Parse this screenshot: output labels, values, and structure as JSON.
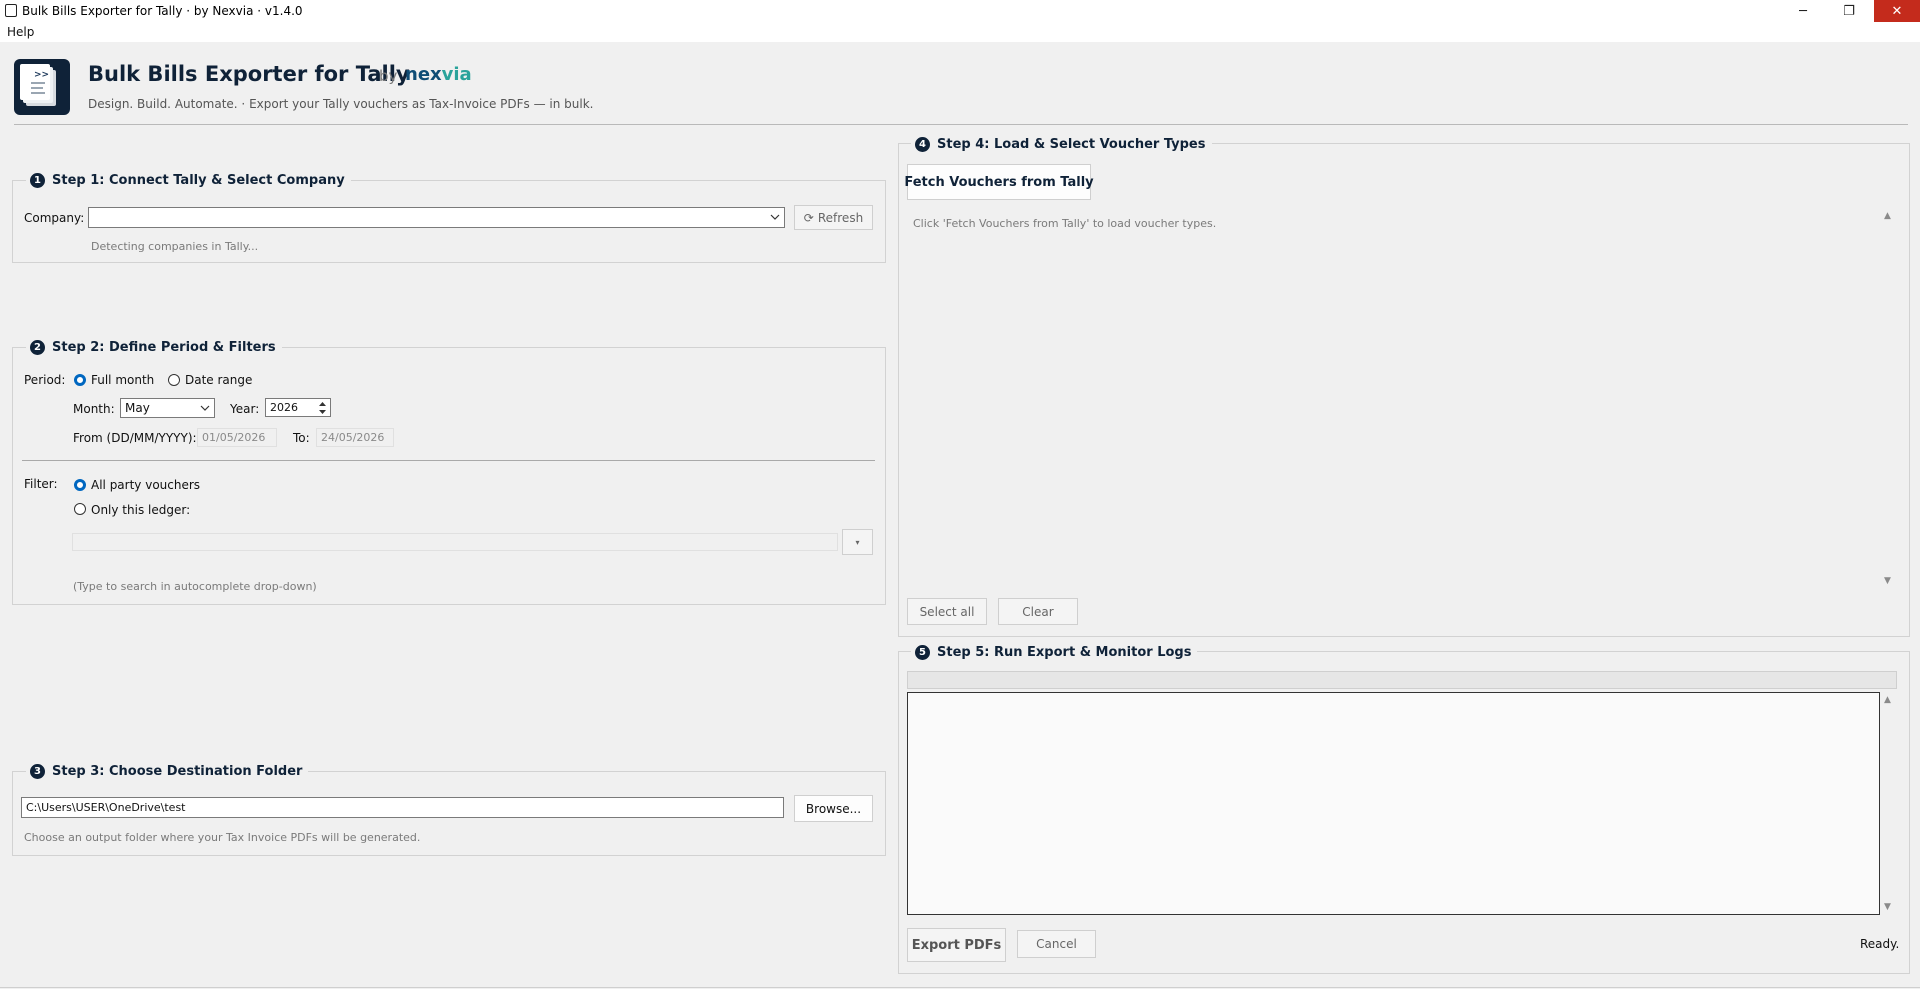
{
  "window": {
    "title": "Bulk Bills Exporter for Tally  ·  by Nexvia  ·  v1.4.0",
    "minimize": "─",
    "restore": "❐",
    "close": "✕"
  },
  "menu": {
    "help": "Help"
  },
  "header": {
    "logo_glyph": ">>",
    "title": "Bulk Bills Exporter for Tally",
    "by": "by",
    "brand_a": "nex",
    "brand_b": "via",
    "subtitle": "Design. Build. Automate.   ·   Export your Tally vouchers as Tax-Invoice PDFs — in bulk."
  },
  "step1": {
    "num": "1",
    "title": "Step 1: Connect Tally & Select Company",
    "company_label": "Company:",
    "company_value": "",
    "refresh_icon": "⟳",
    "refresh_label": "Refresh",
    "status": "Detecting companies in Tally..."
  },
  "step2": {
    "num": "2",
    "title": "Step 2: Define Period & Filters",
    "period_label": "Period:",
    "full_month": "Full month",
    "date_range": "Date range",
    "period_selected": "Full month",
    "month_label": "Month:",
    "month_value": "May",
    "year_label": "Year:",
    "year_value": "2026",
    "from_label": "From (DD/MM/YYYY):",
    "from_value": "01/05/2026",
    "to_label": "To:",
    "to_value": "24/05/2026",
    "filter_label": "Filter:",
    "all_party": "All party vouchers",
    "only_ledger": "Only this ledger:",
    "filter_selected": "All party vouchers",
    "ledger_value": "",
    "ledger_btn": "▾",
    "hint": "(Type to search in autocomplete drop-down)"
  },
  "step3": {
    "num": "3",
    "title": "Step 3: Choose Destination Folder",
    "folder_value": "C:\\Users\\USER\\OneDrive\\test",
    "browse_label": "Browse...",
    "hint": "Choose an output folder where your Tax Invoice PDFs will be generated."
  },
  "step4": {
    "num": "4",
    "title": "Step 4: Load & Select Voucher Types",
    "fetch_label": "Fetch Vouchers from Tally",
    "hint": "Click 'Fetch Vouchers from Tally' to load voucher types.",
    "select_all": "Select all",
    "clear": "Clear"
  },
  "step5": {
    "num": "5",
    "title": "Step 5: Run Export & Monitor Logs",
    "progress": 0,
    "log_text": "",
    "export_label": "Export PDFs",
    "cancel_label": "Cancel",
    "status": "Ready."
  },
  "colors": {
    "navy": "#0f2238",
    "brand_blue": "#0f4c75",
    "brand_teal": "#2aa39b",
    "radio_on": "#0067c0",
    "close_red": "#c42b1c"
  }
}
